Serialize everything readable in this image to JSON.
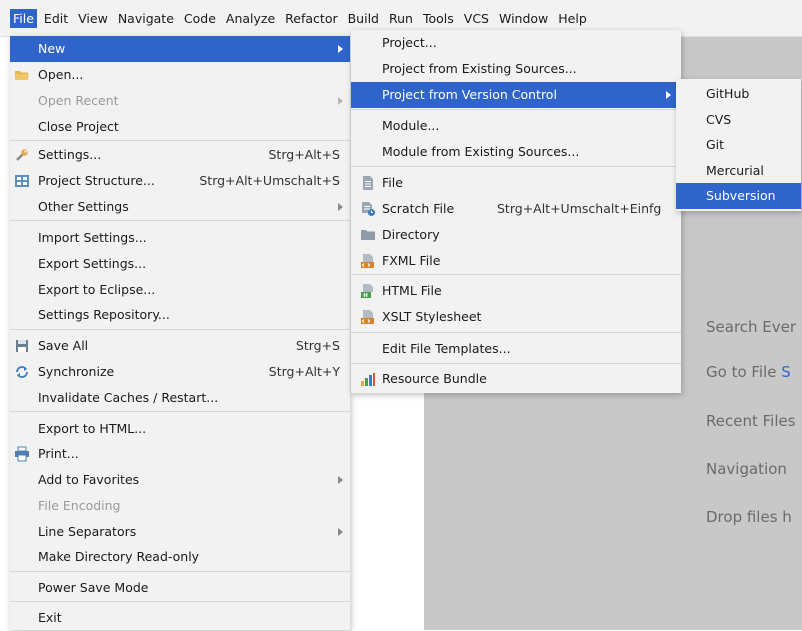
{
  "menubar": {
    "items": [
      {
        "label": "File",
        "active": true
      },
      {
        "label": "Edit"
      },
      {
        "label": "View"
      },
      {
        "label": "Navigate"
      },
      {
        "label": "Code"
      },
      {
        "label": "Analyze"
      },
      {
        "label": "Refactor"
      },
      {
        "label": "Build"
      },
      {
        "label": "Run"
      },
      {
        "label": "Tools"
      },
      {
        "label": "VCS"
      },
      {
        "label": "Window"
      },
      {
        "label": "Help"
      }
    ]
  },
  "file_menu": {
    "items": [
      {
        "label": "New",
        "selected": true,
        "submenu": true
      },
      {
        "label": "Open...",
        "icon": "folder-icon"
      },
      {
        "label": "Open Recent",
        "disabled": true,
        "submenu": true
      },
      {
        "label": "Close Project"
      },
      {
        "label": "Settings...",
        "shortcut": "Strg+Alt+S",
        "icon": "wrench-icon"
      },
      {
        "label": "Project Structure...",
        "shortcut": "Strg+Alt+Umschalt+S",
        "icon": "project-structure-icon"
      },
      {
        "label": "Other Settings",
        "submenu": true
      },
      {
        "label": "Import Settings..."
      },
      {
        "label": "Export Settings..."
      },
      {
        "label": "Export to Eclipse..."
      },
      {
        "label": "Settings Repository..."
      },
      {
        "label": "Save All",
        "shortcut": "Strg+S",
        "icon": "save-icon"
      },
      {
        "label": "Synchronize",
        "shortcut": "Strg+Alt+Y",
        "icon": "sync-icon"
      },
      {
        "label": "Invalidate Caches / Restart..."
      },
      {
        "label": "Export to HTML..."
      },
      {
        "label": "Print...",
        "icon": "print-icon"
      },
      {
        "label": "Add to Favorites",
        "submenu": true
      },
      {
        "label": "File Encoding",
        "disabled": true
      },
      {
        "label": "Line Separators",
        "submenu": true
      },
      {
        "label": "Make Directory Read-only"
      },
      {
        "label": "Power Save Mode"
      },
      {
        "label": "Exit"
      }
    ]
  },
  "new_menu": {
    "items": [
      {
        "label": "Project..."
      },
      {
        "label": "Project from Existing Sources..."
      },
      {
        "label": "Project from Version Control",
        "selected": true,
        "submenu": true
      },
      {
        "label": "Module..."
      },
      {
        "label": "Module from Existing Sources..."
      },
      {
        "label": "File",
        "icon": "file-icon"
      },
      {
        "label": "Scratch File",
        "shortcut": "Strg+Alt+Umschalt+Einfg",
        "icon": "scratch-file-icon"
      },
      {
        "label": "Directory",
        "icon": "directory-icon"
      },
      {
        "label": "FXML File",
        "icon": "fxml-file-icon"
      },
      {
        "label": "HTML File",
        "icon": "html-file-icon"
      },
      {
        "label": "XSLT Stylesheet",
        "icon": "xslt-file-icon"
      },
      {
        "label": "Edit File Templates..."
      },
      {
        "label": "Resource Bundle",
        "icon": "resource-bundle-icon"
      }
    ]
  },
  "vcs_menu": {
    "items": [
      {
        "label": "GitHub"
      },
      {
        "label": "CVS"
      },
      {
        "label": "Git"
      },
      {
        "label": "Mercurial"
      },
      {
        "label": "Subversion",
        "selected": true
      }
    ]
  },
  "editor_hints": {
    "search_everywhere": "Search Ever",
    "go_to_file": "Go to File ",
    "go_to_file_accent": "S",
    "recent_files": "Recent Files",
    "navigation": "Navigation ",
    "drop_files": "Drop files h"
  },
  "colors": {
    "selection": "#2f65ca",
    "menu_bg": "#f2f2f2",
    "editor_bg": "#c8c8c8",
    "hint_text": "#6b6b6b",
    "disabled_text": "#9a9a9a"
  }
}
